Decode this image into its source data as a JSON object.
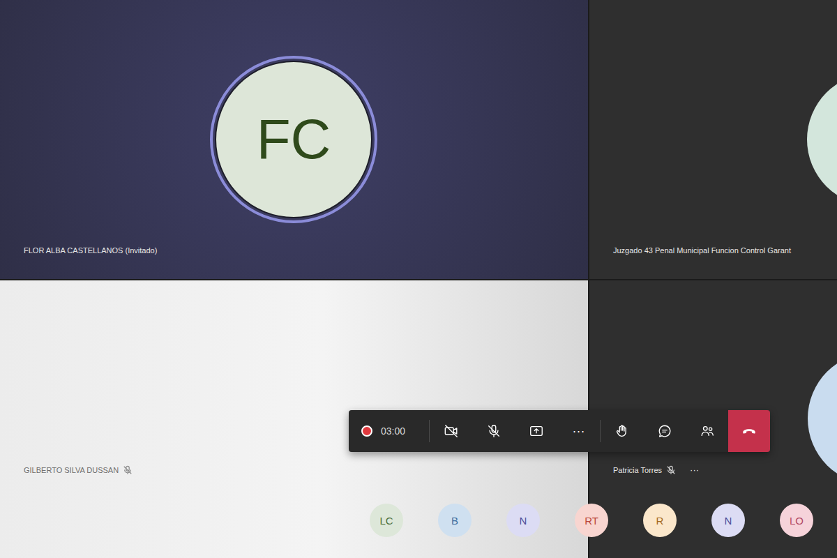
{
  "tiles": [
    {
      "name": "FLOR ALBA CASTELLANOS (Invitado)",
      "initials": "FC",
      "kind": "avatar",
      "speaking": true,
      "muted": false,
      "color": "#dde6d8"
    },
    {
      "name": "Juzgado 43 Penal Municipal Funcion Control Garant",
      "kind": "edge-avatar",
      "speaking": false,
      "muted": false,
      "color": "#d3e6dc"
    },
    {
      "name": "GILBERTO SILVA DUSSAN",
      "kind": "video",
      "speaking": false,
      "muted": true
    },
    {
      "name": "Patricia Torres",
      "kind": "edge-avatar",
      "speaking": false,
      "muted": true,
      "color": "#c9dcef",
      "menu": "···"
    }
  ],
  "toolbar": {
    "recording": true,
    "timer": "03:00",
    "camera_on": false,
    "mic_on": false,
    "more": "···"
  },
  "roster": [
    {
      "initials": "LC",
      "color": "#dde7d9",
      "text_color": "#4d6f3a"
    },
    {
      "initials": "B",
      "color": "#cfe0f0",
      "text_color": "#3b6fa0"
    },
    {
      "initials": "N",
      "color": "#dcdcf4",
      "text_color": "#4e4f9a"
    },
    {
      "initials": "RT",
      "color": "#f8d5d0",
      "text_color": "#b8473d"
    },
    {
      "initials": "R",
      "color": "#fbe7cb",
      "text_color": "#a46a1f"
    },
    {
      "initials": "N",
      "color": "#dcdcf4",
      "text_color": "#4e4f9a"
    },
    {
      "initials": "LO",
      "color": "#f6d3da",
      "text_color": "#b24a63"
    }
  ]
}
